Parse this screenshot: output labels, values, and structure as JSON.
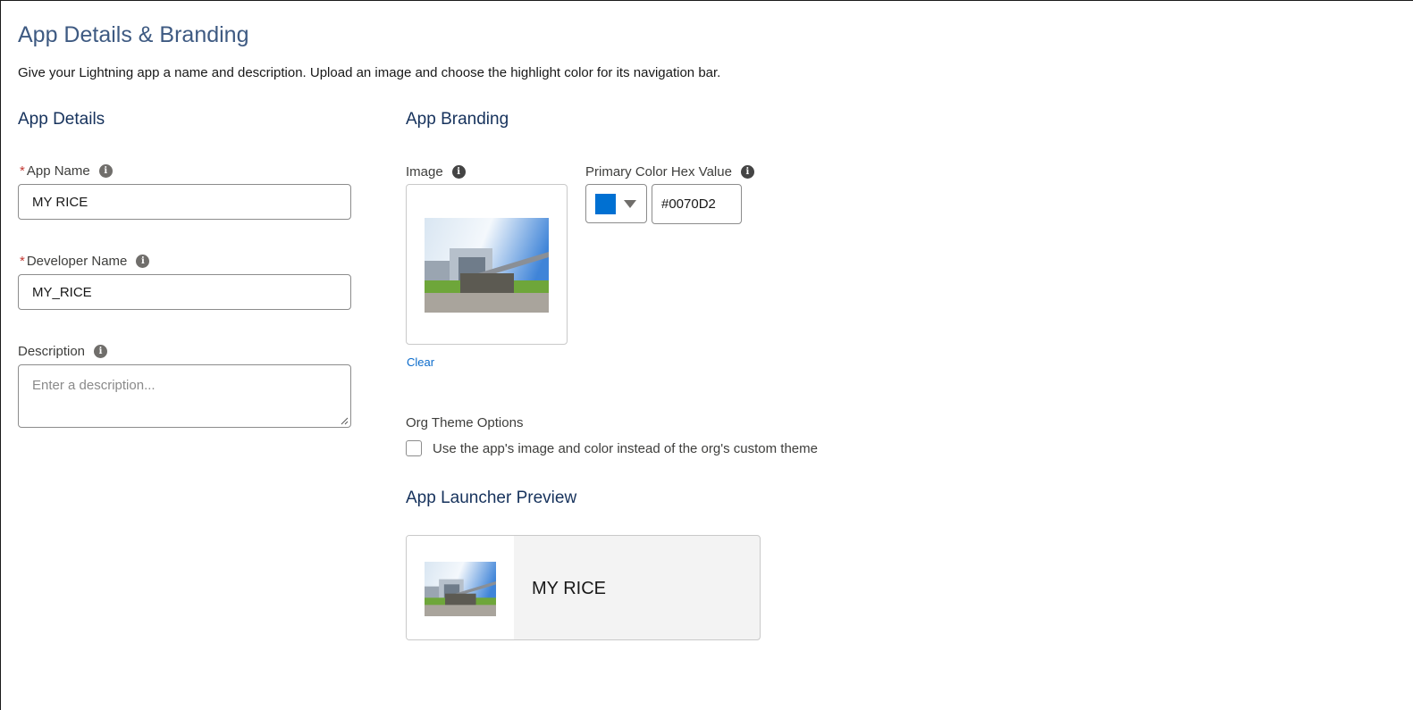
{
  "header": {
    "title": "App Details & Branding",
    "subtitle": "Give your Lightning app a name and description. Upload an image and choose the highlight color for its navigation bar."
  },
  "details": {
    "section_title": "App Details",
    "required_mark": "*",
    "app_name": {
      "label": "App Name",
      "value": "MY RICE",
      "info_icon": "info-icon"
    },
    "developer_name": {
      "label": "Developer Name",
      "value": "MY_RICE",
      "info_icon": "info-icon"
    },
    "description": {
      "label": "Description",
      "placeholder": "Enter a description...",
      "value": "",
      "info_icon": "info-icon"
    }
  },
  "branding": {
    "section_title": "App Branding",
    "image": {
      "label": "Image",
      "clear_label": "Clear",
      "info_icon": "info-icon"
    },
    "color": {
      "label": "Primary Color Hex Value",
      "value": "#0070D2",
      "swatch": "#0070D2",
      "dropdown_icon": "caret-down-icon"
    },
    "theme": {
      "label": "Org Theme Options",
      "checkbox_label": "Use the app's image and color instead of the org's custom theme",
      "checked": false
    }
  },
  "preview": {
    "section_title": "App Launcher Preview",
    "app_name": "MY RICE"
  },
  "colors": {
    "accent": "#0070D2",
    "heading": "#16325c",
    "link": "#0b6bcb",
    "required": "#c23934"
  }
}
